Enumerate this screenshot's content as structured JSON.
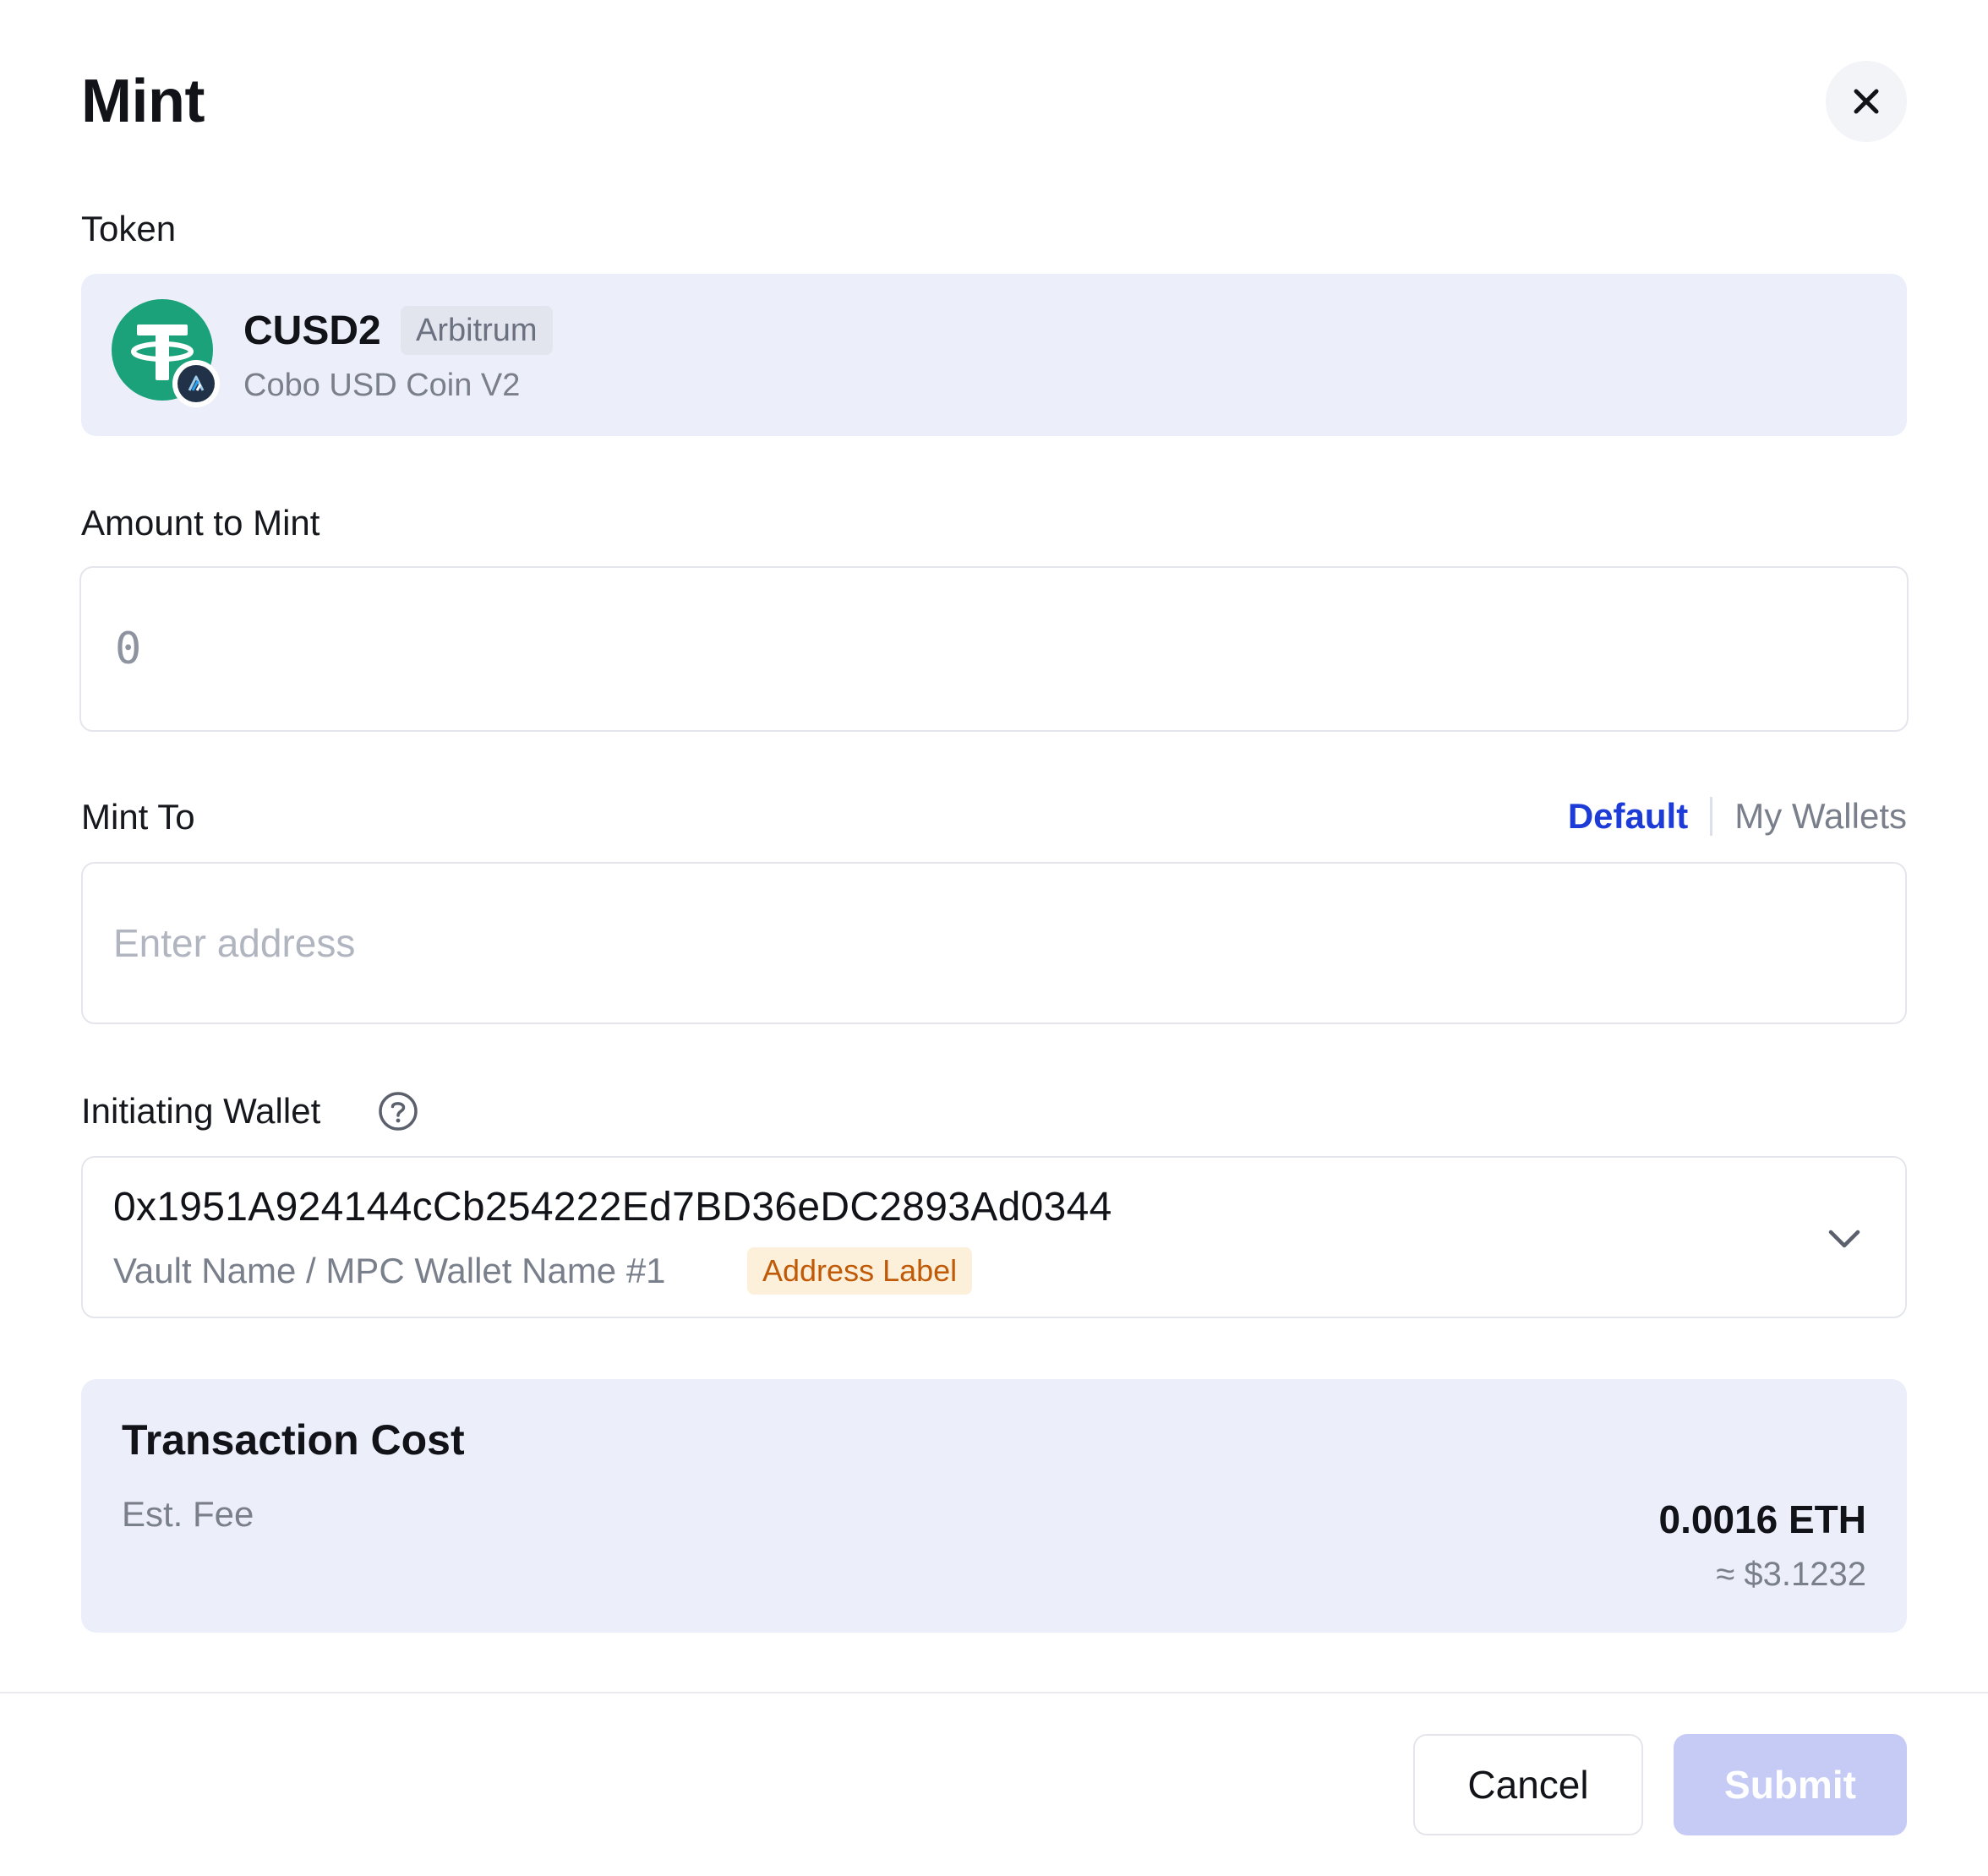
{
  "dialog": {
    "title": "Mint",
    "close_icon": "close-icon"
  },
  "token": {
    "label": "Token",
    "symbol": "CUSD2",
    "chain": "Arbitrum",
    "name": "Cobo USD Coin V2",
    "logo_icon": "tether-icon",
    "chain_icon": "arbitrum-icon",
    "logo_color": "#1ba27a"
  },
  "amount": {
    "label": "Amount to Mint",
    "value": "0"
  },
  "mint_to": {
    "label": "Mint To",
    "options": [
      "Default",
      "My Wallets"
    ],
    "selected": "Default",
    "placeholder": "Enter address"
  },
  "initiating_wallet": {
    "label": "Initiating Wallet",
    "help_icon": "question-circle-icon",
    "address": "0x1951A924144cCb254222Ed7BD36eDC2893Ad0344",
    "wallet_name": "Vault Name / MPC Wallet Name #1",
    "address_label": "Address Label",
    "chevron_icon": "chevron-down-icon"
  },
  "transaction_cost": {
    "title": "Transaction Cost",
    "fee_label": "Est. Fee",
    "fee_eth": "0.0016 ETH",
    "fee_usd": "≈ $3.1232"
  },
  "footer": {
    "cancel_label": "Cancel",
    "submit_label": "Submit"
  },
  "colors": {
    "accent": "#1d3bd6",
    "submit_disabled": "#c5cbf5",
    "card_bg": "#eceffa",
    "label_tag_bg": "#fdf0db",
    "label_tag_text": "#c05a06"
  }
}
